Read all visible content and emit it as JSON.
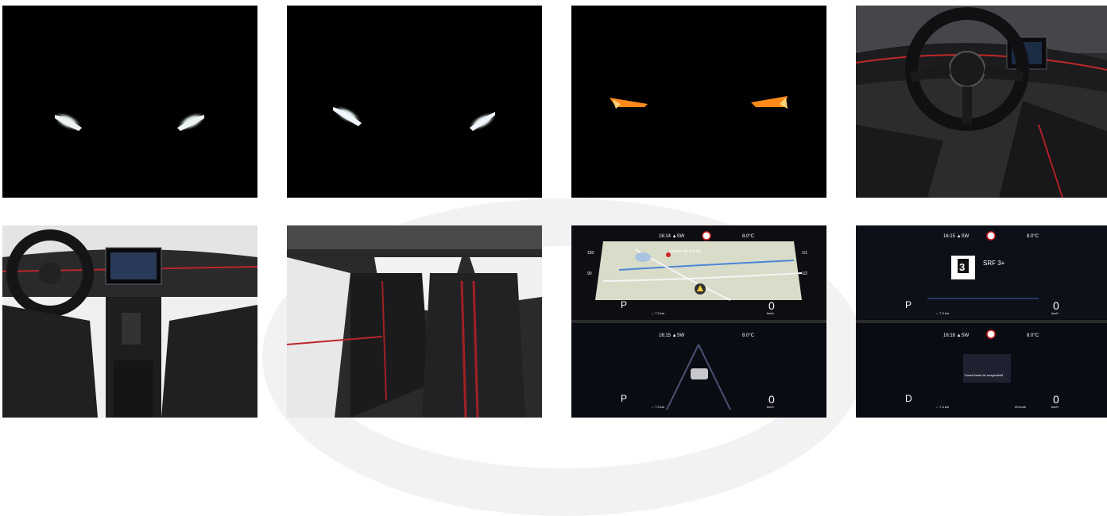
{
  "gallery": {
    "tiles": [
      {
        "name": "headlights-white"
      },
      {
        "name": "headlights-white-angle"
      },
      {
        "name": "rear-lights-orange"
      },
      {
        "name": "cockpit-steering-wheel"
      },
      {
        "name": "interior-dashboard-front"
      },
      {
        "name": "rear-seats"
      },
      {
        "name": "cluster-navigation"
      },
      {
        "name": "cluster-radio"
      }
    ]
  },
  "cluster_nav_top": {
    "status": "16:14 ▲SW",
    "temp": "8.0°C",
    "limit": "80",
    "map_label": "Skoda Herzog AG",
    "gear": "P",
    "speed": "0",
    "speed_unit": "km/h",
    "range": "⇔ 7.3 km",
    "scale_top": "150",
    "scale_mid": "90",
    "scale_right_top": "1/1",
    "scale_right_mid": "1/2"
  },
  "cluster_nav_bottom": {
    "status": "16:15 ▲SW",
    "temp": "8.0°C",
    "gear": "P",
    "speed": "0",
    "speed_unit": "km/h",
    "range": "⇔ 7.3 km"
  },
  "cluster_radio_top": {
    "status": "16:15 ▲SW",
    "temp": "8.0°C",
    "station": "SRF 3+",
    "logo_big": "3",
    "logo_small": "RADIO SRF",
    "gear": "P",
    "speed": "0",
    "speed_unit": "km/h",
    "range": "⇔ 7.3 km"
  },
  "cluster_radio_bottom": {
    "status": "16:16 ▲SW",
    "temp": "8.0°C",
    "message": "Travel Assist ist ausgewählt",
    "gear": "D",
    "speed": "0",
    "speed_unit": "km/h",
    "range": "⇔ 7.3 km",
    "range_right": "20 km/h"
  }
}
